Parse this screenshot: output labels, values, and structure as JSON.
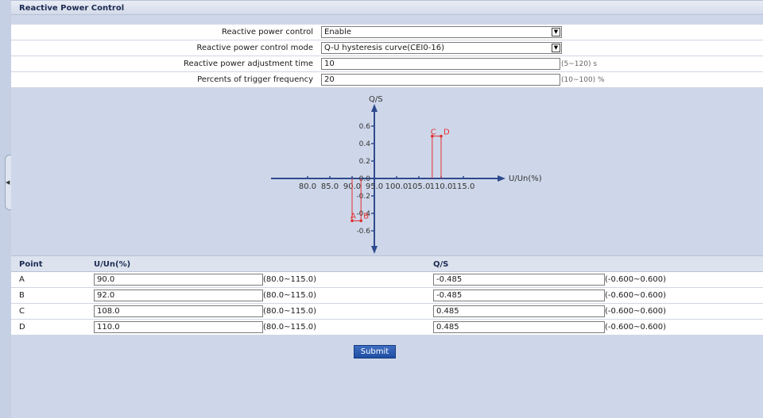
{
  "panel": {
    "title": "Reactive Power Control"
  },
  "form": {
    "control": {
      "label": "Reactive power control",
      "value": "Enable"
    },
    "mode": {
      "label": "Reactive power control mode",
      "value": "Q-U hysteresis curve(CEI0-16)"
    },
    "adjust_time": {
      "label": "Reactive power adjustment time",
      "value": "10",
      "range": "(5~120) s"
    },
    "trigger_freq": {
      "label": "Percents of trigger frequency",
      "value": "20",
      "range": "(10~100) %"
    }
  },
  "chart_data": {
    "type": "line",
    "xlabel": "U/Un(%)",
    "ylabel": "Q/S",
    "x_ticks": [
      "80.0",
      "85.0",
      "90.0",
      "95.0",
      "100.0",
      "105.0",
      "110.0",
      "115.0"
    ],
    "y_ticks": [
      "0.6",
      "0.4",
      "0.2",
      "0.0",
      "-0.2",
      "-0.4",
      "-0.6"
    ],
    "xlim": [
      75,
      120
    ],
    "ylim": [
      -0.8,
      0.8
    ],
    "points": [
      {
        "name": "A",
        "x": 90.0,
        "y": -0.485
      },
      {
        "name": "B",
        "x": 92.0,
        "y": -0.485
      },
      {
        "name": "C",
        "x": 108.0,
        "y": 0.485
      },
      {
        "name": "D",
        "x": 110.0,
        "y": 0.485
      }
    ],
    "curve_color": "#e03030",
    "axis_color": "#2e4a8e"
  },
  "table": {
    "headers": {
      "point": "Point",
      "u": "U/Un(%)",
      "q": "Q/S"
    },
    "rows": [
      {
        "point": "A",
        "u": "90.0",
        "u_range": "(80.0~115.0)",
        "q": "-0.485",
        "q_range": "(-0.600~0.600)"
      },
      {
        "point": "B",
        "u": "92.0",
        "u_range": "(80.0~115.0)",
        "q": "-0.485",
        "q_range": "(-0.600~0.600)"
      },
      {
        "point": "C",
        "u": "108.0",
        "u_range": "(80.0~115.0)",
        "q": "0.485",
        "q_range": "(-0.600~0.600)"
      },
      {
        "point": "D",
        "u": "110.0",
        "u_range": "(80.0~115.0)",
        "q": "0.485",
        "q_range": "(-0.600~0.600)"
      }
    ]
  },
  "submit_label": "Submit"
}
